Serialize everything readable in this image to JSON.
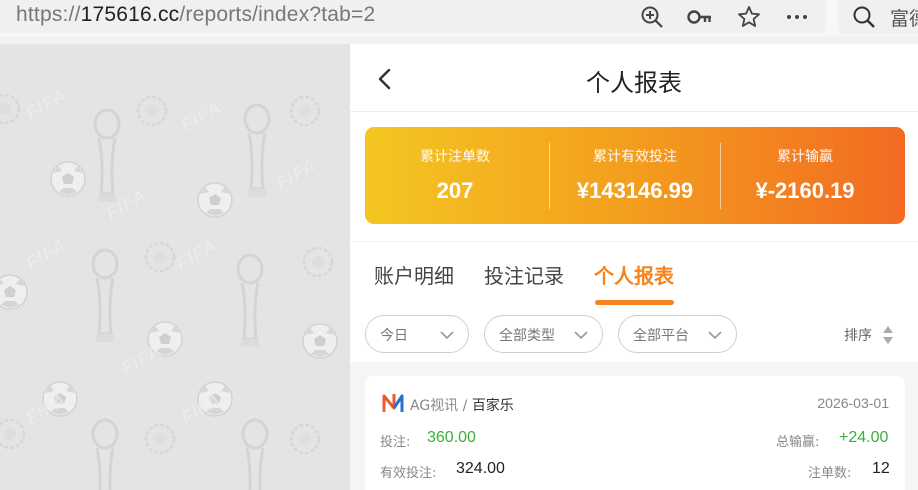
{
  "browser": {
    "url_scheme": "https://",
    "url_host": "175616.cc",
    "url_path": "/reports/index?tab=2",
    "search_placeholder": "富德",
    "icons": [
      "zoom-in-icon",
      "key-icon",
      "star-icon",
      "more-icon",
      "search-icon"
    ]
  },
  "background": {
    "motif_text": "FIFA"
  },
  "header": {
    "title": "个人报表"
  },
  "summary": {
    "stats": [
      {
        "label": "累计注单数",
        "value": "207"
      },
      {
        "label": "累计有效投注",
        "value": "¥143146.99"
      },
      {
        "label": "累计输赢",
        "value": "¥-2160.19"
      }
    ],
    "gradient": [
      "#f5c622",
      "#f39d1e",
      "#f36a22"
    ]
  },
  "tabs": [
    {
      "label": "账户明细",
      "active": false
    },
    {
      "label": "投注记录",
      "active": false
    },
    {
      "label": "个人报表",
      "active": true
    }
  ],
  "accent_color": "#f5841f",
  "filters": [
    {
      "label": "今日"
    },
    {
      "label": "全部类型"
    },
    {
      "label": "全部平台"
    }
  ],
  "sort": {
    "label": "排序"
  },
  "records": [
    {
      "platform": "AG视讯",
      "separator": " / ",
      "game": "百家乐",
      "date": "2026-03-01",
      "bet_label": "投注:",
      "bet_value": "360.00",
      "winloss_label": "总输赢:",
      "winloss_value": "+24.00",
      "valid_label": "有效投注:",
      "valid_value": "324.00",
      "count_label": "注单数:",
      "count_value": "12",
      "win_color": "#3cae3c"
    }
  ]
}
